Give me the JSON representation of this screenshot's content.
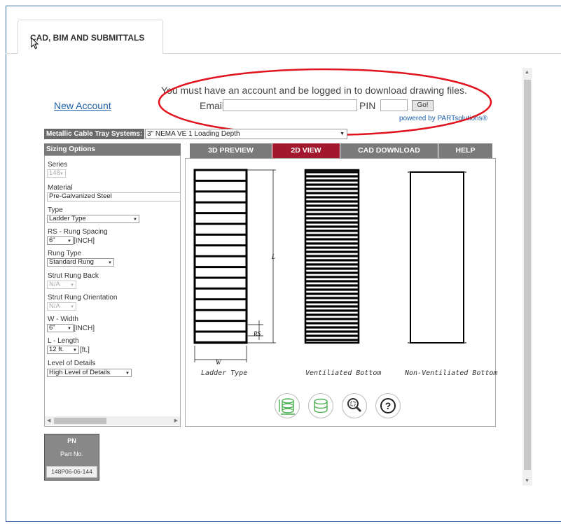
{
  "tabs": [
    {
      "label": "CAD, BIM AND SUBMITTALS"
    }
  ],
  "login": {
    "message": "You must have an account and be logged in to download drawing files.",
    "new_account": "New Account",
    "email_label": "Email",
    "email_value": "",
    "pin_label": "PIN",
    "pin_value": "",
    "go_label": "Go!",
    "powered_by": "powered by PARTsolutions®"
  },
  "systems": {
    "label": "Metallic Cable Tray Systems:",
    "selected": "3\" NEMA VE 1 Loading Depth"
  },
  "sizing": {
    "header": "Sizing Options",
    "series": {
      "label": "Series",
      "value": "148"
    },
    "material": {
      "label": "Material",
      "value": "Pre-Galvanized Steel"
    },
    "type": {
      "label": "Type",
      "value": "Ladder Type"
    },
    "rung_spacing": {
      "label": "RS - Rung Spacing",
      "value": "6\"",
      "unit": "[INCH]"
    },
    "rung_type": {
      "label": "Rung Type",
      "value": "Standard Rung"
    },
    "strut_back": {
      "label": "Strut Rung Back",
      "value": "N/A"
    },
    "strut_orientation": {
      "label": "Strut Rung Orientation",
      "value": "N/A"
    },
    "width": {
      "label": "W - Width",
      "value": "6\"",
      "unit": "[INCH]"
    },
    "length": {
      "label": "L - Length",
      "value": "12 ft.",
      "unit": "[ft.]"
    },
    "details": {
      "label": "Level of Details",
      "value": "High Level of Details"
    }
  },
  "view_tabs": [
    {
      "label": "3D PREVIEW"
    },
    {
      "label": "2D VIEW"
    },
    {
      "label": "CAD DOWNLOAD"
    },
    {
      "label": "HELP"
    }
  ],
  "drawing": {
    "captions": [
      "Ladder Type",
      "Ventiliated Bottom",
      "Non-Ventiliated Bottom"
    ],
    "dim_labels": {
      "length": "L",
      "width": "W",
      "rung_spacing": "RS"
    }
  },
  "part_number": {
    "header": "PN",
    "subheader": "Part No.",
    "value": "148P06-06-144"
  },
  "colors": {
    "active_tab": "#a3172e",
    "tab_gray": "#7a7a7a",
    "annotation": "#e0141e",
    "link": "#1a5fa8",
    "tool_green": "#4caf50"
  },
  "icons": [
    "cursor-icon",
    "ladder-dimension-icon",
    "cylinder-icon",
    "zoom-icon",
    "help-icon"
  ]
}
